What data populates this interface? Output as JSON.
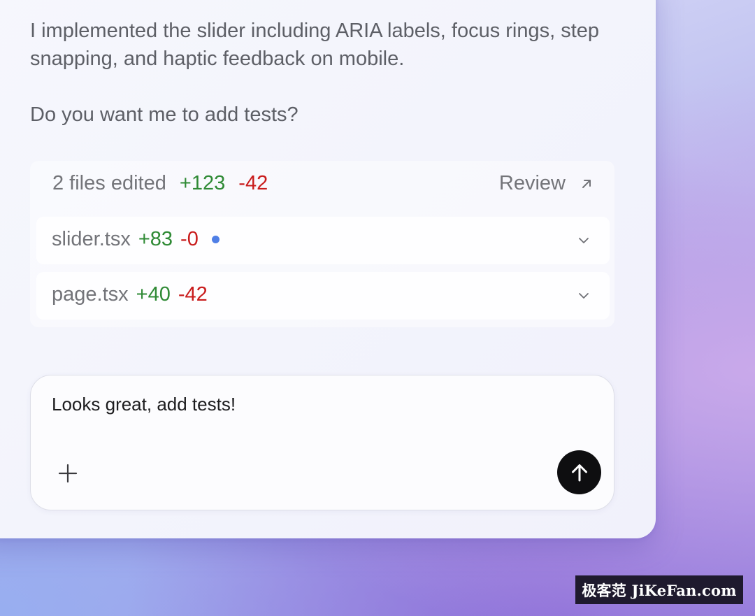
{
  "message": {
    "line1": "I implemented the slider including ARIA labels, focus rings, step snapping, and haptic feedback on mobile.",
    "line2": "Do you want me to add tests?"
  },
  "changes": {
    "summary_label": "2 files edited",
    "additions": "+123",
    "deletions": "-42",
    "review_label": "Review",
    "files": [
      {
        "name": "slider.tsx",
        "additions": "+83",
        "deletions": "-0",
        "modified_indicator": true
      },
      {
        "name": "page.tsx",
        "additions": "+40",
        "deletions": "-42",
        "modified_indicator": false
      }
    ]
  },
  "composer": {
    "value": "Looks great, add tests!",
    "add_icon": "plus-icon",
    "send_icon": "arrow-up-icon"
  },
  "watermark": {
    "text": "极客范 JiKeFan.com"
  },
  "colors": {
    "additions": "#2f8a35",
    "deletions": "#c91c1c",
    "indicator": "#4f7fe6",
    "send_button": "#0e0e10"
  }
}
